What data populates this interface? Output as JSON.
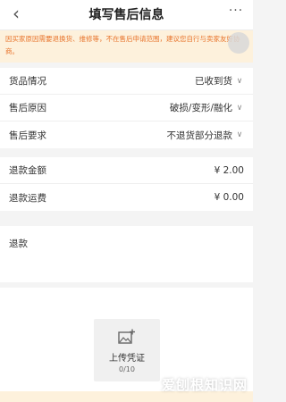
{
  "header": {
    "title": "填写售后信息",
    "back_icon": "chevron-left-icon",
    "more_icon": "more-dots-icon",
    "more_glyph": "···"
  },
  "notice": {
    "text": "因买家原因需要退换货、维修等，不在售后申请范围，建议您自行与卖家友好协商。"
  },
  "form": {
    "rows": [
      {
        "label": "货品情况",
        "value": "已收到货"
      },
      {
        "label": "售后原因",
        "value": "破损/变形/融化"
      },
      {
        "label": "售后要求",
        "value": "不退货部分退款"
      }
    ],
    "refund_amount": {
      "label": "退款金额",
      "value": "¥ 2.00"
    },
    "refund_shipping": {
      "label": "退款运费",
      "value": "¥ 0.00"
    },
    "reason": {
      "label": "退款"
    }
  },
  "upload": {
    "label": "上传凭证",
    "count": "0/10",
    "icon": "add-image-icon"
  },
  "watermark": "爱刨根知识网",
  "colors": {
    "notice_bg": "#fdf1dc",
    "notice_text": "#e8742c",
    "background": "#f4f4f4"
  }
}
